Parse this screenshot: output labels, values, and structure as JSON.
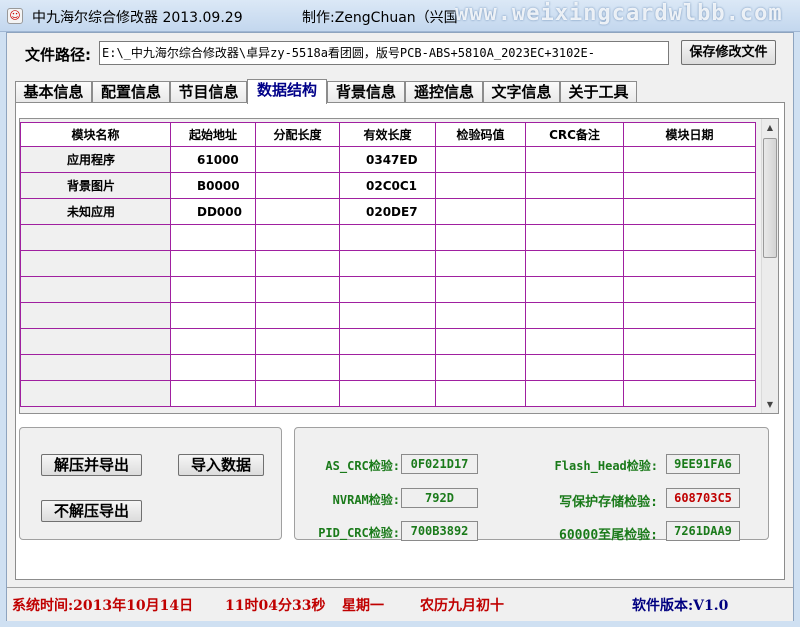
{
  "window": {
    "title": "中九海尔综合修改器 2013.09.29",
    "author": "制作:ZengChuan（兴国",
    "watermark": "www.weixingcardwlbb.com"
  },
  "path": {
    "label": "文件路径:",
    "value": "E:\\_中九海尔综合修改器\\卓异zy-5518a看团圆，版号PCB-ABS+5810A_2023EC+3102E-",
    "save_label": "保存修改文件"
  },
  "tabs": [
    {
      "label": "基本信息"
    },
    {
      "label": "配置信息"
    },
    {
      "label": "节目信息"
    },
    {
      "label": "数据结构",
      "active": true
    },
    {
      "label": "背景信息"
    },
    {
      "label": "遥控信息"
    },
    {
      "label": "文字信息"
    },
    {
      "label": "关于工具"
    }
  ],
  "grid": {
    "columns": [
      "模块名称",
      "起始地址",
      "分配长度",
      "有效长度",
      "检验码值",
      "CRC备注",
      "模块日期"
    ],
    "rows": [
      [
        "应用程序",
        "61000",
        "",
        "0347ED",
        "",
        "",
        ""
      ],
      [
        "背景图片",
        "B0000",
        "",
        "02C0C1",
        "",
        "",
        ""
      ],
      [
        "未知应用",
        "DD000",
        "",
        "020DE7",
        "",
        "",
        ""
      ],
      [
        "",
        "",
        "",
        "",
        "",
        "",
        ""
      ],
      [
        "",
        "",
        "",
        "",
        "",
        "",
        ""
      ],
      [
        "",
        "",
        "",
        "",
        "",
        "",
        ""
      ],
      [
        "",
        "",
        "",
        "",
        "",
        "",
        ""
      ],
      [
        "",
        "",
        "",
        "",
        "",
        "",
        ""
      ],
      [
        "",
        "",
        "",
        "",
        "",
        "",
        ""
      ],
      [
        "",
        "",
        "",
        "",
        "",
        "",
        ""
      ]
    ]
  },
  "actions": {
    "decompress_export": "解压并导出",
    "import_data": "导入数据",
    "no_decompress_export": "不解压导出"
  },
  "checks": {
    "as_crc_label": "AS_CRC检验:",
    "as_crc_value": "0F021D17",
    "nvram_label": "NVRAM检验:",
    "nvram_value": "792D",
    "pid_crc_label": "PID_CRC检验:",
    "pid_crc_value": "700B3892",
    "flash_head_label": "Flash_Head检验:",
    "flash_head_value": "9EE91FA6",
    "write_protect_label": "写保护存储检验:",
    "write_protect_value": "608703C5",
    "tail_label": "60000至尾检验:",
    "tail_value": "7261DAA9"
  },
  "status": {
    "system_time": "系统时间:2013年10月14日",
    "clock": "11时04分33秒",
    "weekday": "星期一",
    "lunar": "农历九月初十",
    "version": "软件版本:V1.0"
  },
  "colors": {
    "grid_border": "#a020a0",
    "check_text": "#1a7a1a",
    "status_text": "#c00000",
    "version_text": "#000080"
  }
}
